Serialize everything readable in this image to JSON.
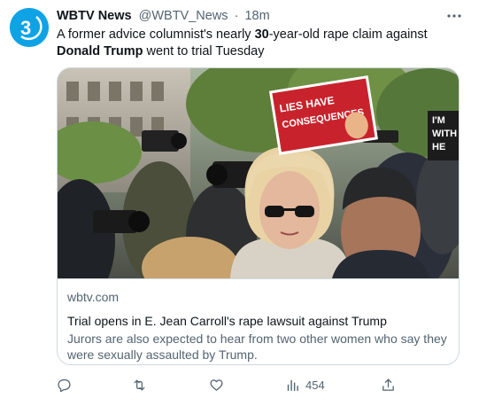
{
  "tweet": {
    "avatar_text": "3",
    "display_name": "WBTV News",
    "handle": "@WBTV_News",
    "separator": "·",
    "time": "18m",
    "text_part1": "A former advice columnist's nearly ",
    "text_bold1": "30",
    "text_part2": "-year-old rape claim against ",
    "text_bold2": "Donald Trump",
    "text_part3": " went to trial Tuesday"
  },
  "card": {
    "photo_signs": {
      "sign1_line1": "LIES HAVE",
      "sign1_line2": "CONSEQUENCES",
      "sign2_line1": "I'M",
      "sign2_line2": "WITH",
      "sign2_line3": "HE"
    },
    "domain": "wbtv.com",
    "title": "Trial opens in E. Jean Carroll's rape lawsuit against Trump",
    "description": "Jurors are also expected to hear from two other women who say they were sexually assaulted by Trump."
  },
  "actions": {
    "reply_icon": "reply-icon",
    "retweet_icon": "retweet-icon",
    "like_icon": "heart-icon",
    "views_icon": "views-chart-icon",
    "views_count": "454",
    "share_icon": "share-icon"
  },
  "colors": {
    "brand_avatar": "#0fa3e6",
    "text": "#0f1419",
    "muted": "#536471",
    "border": "#cfd9de",
    "sign_red": "#c8232c"
  }
}
